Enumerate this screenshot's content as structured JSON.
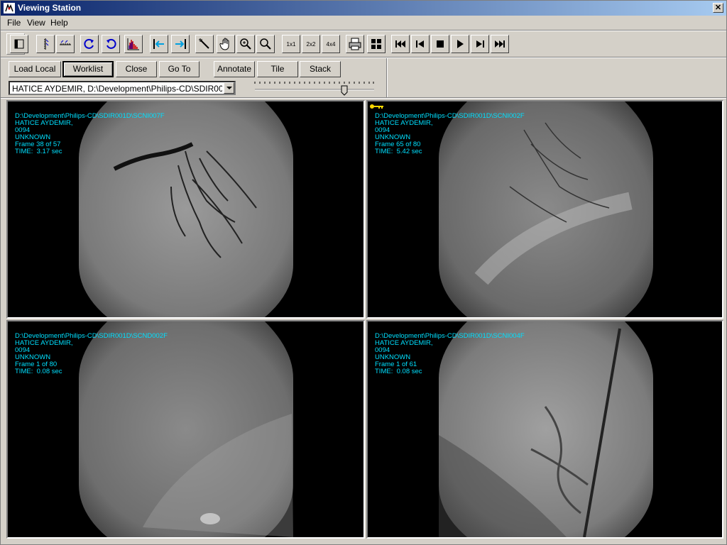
{
  "window": {
    "title": "Viewing Station",
    "close_glyph": "✕"
  },
  "menu": [
    "File",
    "View",
    "Help"
  ],
  "toolbar_layout_buttons": [
    "1x1",
    "2x2",
    "4x4"
  ],
  "panel_buttons": {
    "load_local": "Load Local",
    "worklist": "Worklist",
    "close": "Close",
    "goto": "Go To",
    "annotate": "Annotate",
    "tile": "Tile",
    "stack": "Stack"
  },
  "patient_combo": {
    "value": "HATICE AYDEMIR,  D:\\Development\\Philips-CD\\SDIR001D\\S"
  },
  "slider": {
    "position_fraction": 0.75
  },
  "viewports": [
    {
      "path": "D:\\Development\\Philips-CD\\SDIR001D\\SCNI007F",
      "patient": "HATICE AYDEMIR,",
      "id": "0094",
      "status": "UNKNOWN",
      "frame": "Frame 38 of 57",
      "time": "TIME:  3.17 sec"
    },
    {
      "path": "D:\\Development\\Philips-CD\\SDIR001D\\SCNI002F",
      "patient": "HATICE AYDEMIR,",
      "id": "0094",
      "status": "UNKNOWN",
      "frame": "Frame 65 of 80",
      "time": "TIME:  5.42 sec"
    },
    {
      "path": "D:\\Development\\Philips-CD\\SDIR001D\\SCND002F",
      "patient": "HATICE AYDEMIR,",
      "id": "0094",
      "status": "UNKNOWN",
      "frame": "Frame 1 of 80",
      "time": "TIME:  0.08 sec"
    },
    {
      "path": "D:\\Development\\Philips-CD\\SDIR001D\\SCNI004F",
      "patient": "HATICE AYDEMIR,",
      "id": "0094",
      "status": "UNKNOWN",
      "frame": "Frame 1 of 61",
      "time": "TIME:  0.08 sec"
    }
  ],
  "colors": {
    "overlay_text": "#00e0ff",
    "titlebar_start": "#0a246a",
    "titlebar_end": "#a6caf0",
    "key_icon": "#ffd700"
  }
}
